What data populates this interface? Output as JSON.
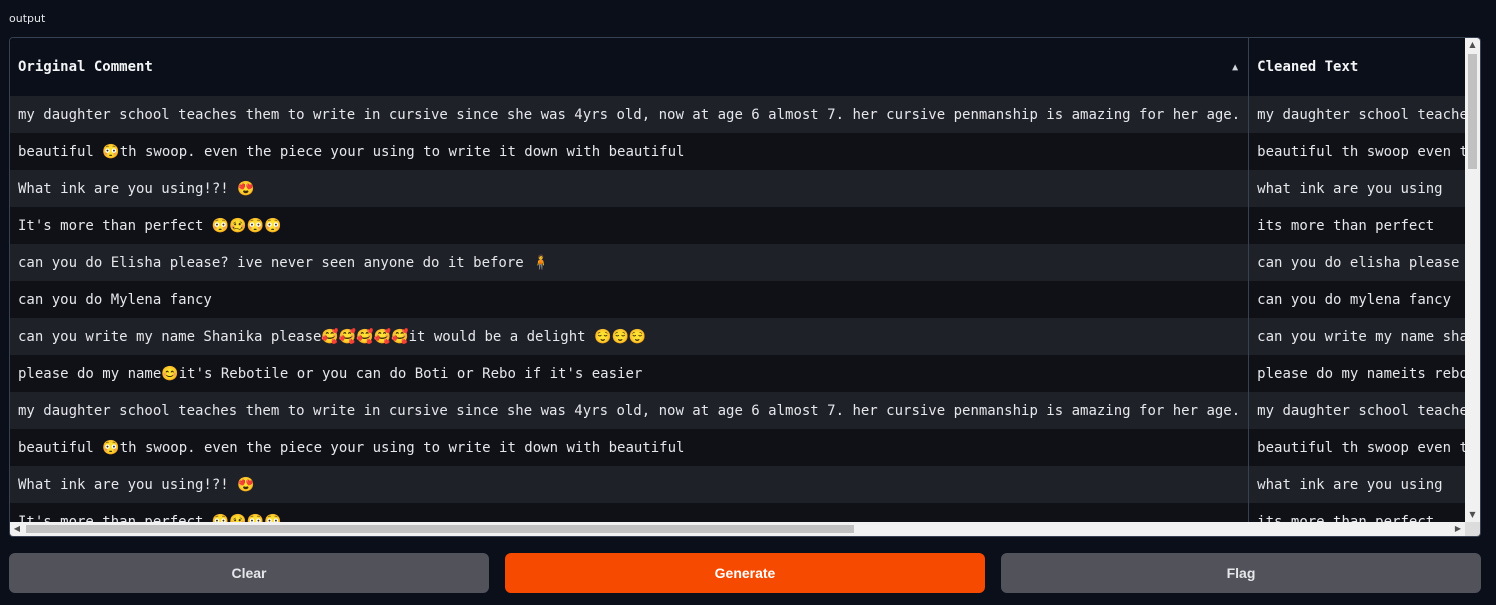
{
  "output": {
    "label": "output"
  },
  "table": {
    "headers": [
      "Original Comment",
      "Cleaned Text"
    ],
    "sort_icon": "▲",
    "rows": [
      [
        "my daughter school teaches them to write in cursive since she was 4yrs old, now at age 6 almost 7. her cursive penmanship is amazing for her age.",
        "my daughter school teaches them to write in cursive since she was yrs old now at age almost her cursive penmanship is amazing for her age"
      ],
      [
        "beautiful 😳th swoop. even the piece your using to write it down with beautiful",
        "beautiful th swoop even the piece your using to write it down with beautiful"
      ],
      [
        "What ink are you using!?! 😍",
        "what ink are you using"
      ],
      [
        "It's more than perfect 😳🥴😳😳",
        "its more than perfect"
      ],
      [
        "can you do Elisha please? ive never seen anyone do it before 🧍",
        "can you do elisha please ive never seen anyone do it before"
      ],
      [
        "can you do Mylena fancy",
        "can you do mylena fancy"
      ],
      [
        "can you write my name Shanika please🥰🥰🥰🥰🥰it would be a delight 😌😌😌",
        "can you write my name shanika pleaseit would be a delight"
      ],
      [
        "please do my name😊it's Rebotile or you can do Boti or Rebo if it's easier",
        "please do my nameits rebotile or you can do boti or rebo if its easier"
      ],
      [
        "my daughter school teaches them to write in cursive since she was 4yrs old, now at age 6 almost 7. her cursive penmanship is amazing for her age.",
        "my daughter school teaches them to write in cursive since she was yrs old now at age almost her cursive penmanship is amazing for her age"
      ],
      [
        "beautiful 😳th swoop. even the piece your using to write it down with beautiful",
        "beautiful th swoop even the piece your using to write it down with beautiful"
      ],
      [
        "What ink are you using!?! 😍",
        "what ink are you using"
      ],
      [
        "It's more than perfect 😳🥴😳😳",
        "its more than perfect"
      ]
    ]
  },
  "buttons": {
    "clear": "Clear",
    "generate": "Generate",
    "flag": "Flag"
  },
  "colors": {
    "background": "#0b0f19",
    "primary": "#f54a00",
    "secondary": "#52525b"
  }
}
